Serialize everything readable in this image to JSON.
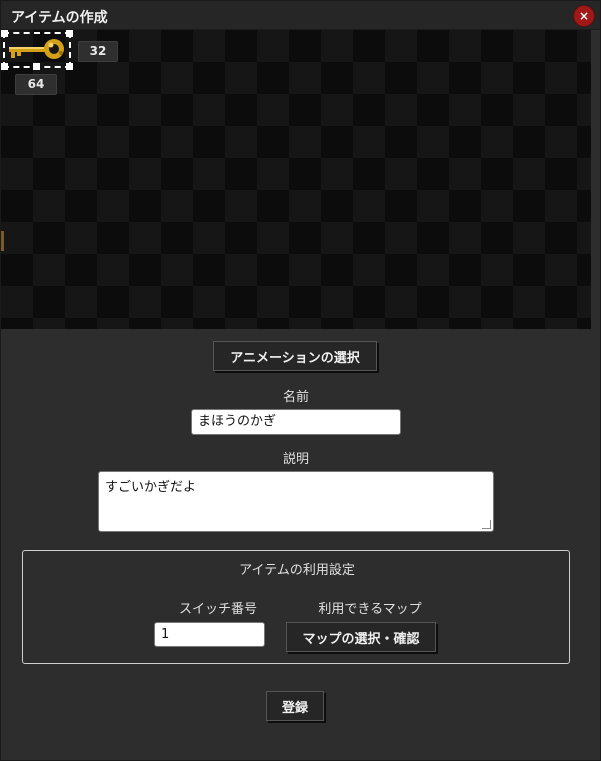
{
  "dialog": {
    "title": "アイテムの作成",
    "close_label": "×"
  },
  "preview": {
    "sprite_icon": "golden-key-icon",
    "width_value": "32",
    "height_value": "64"
  },
  "buttons": {
    "animation_select": "アニメーションの選択",
    "map_select": "マップの選択・確認",
    "register": "登録"
  },
  "form": {
    "name_label": "名前",
    "name_value": "まほうのかぎ",
    "description_label": "説明",
    "description_value": "すごいかぎだよ"
  },
  "usage_settings": {
    "legend": "アイテムの利用設定",
    "switch_label": "スイッチ番号",
    "switch_value": "1",
    "map_label": "利用できるマップ"
  },
  "colors": {
    "background": "#2d2d2d",
    "close_button": "#a01818",
    "key_gold": "#d4a017"
  }
}
